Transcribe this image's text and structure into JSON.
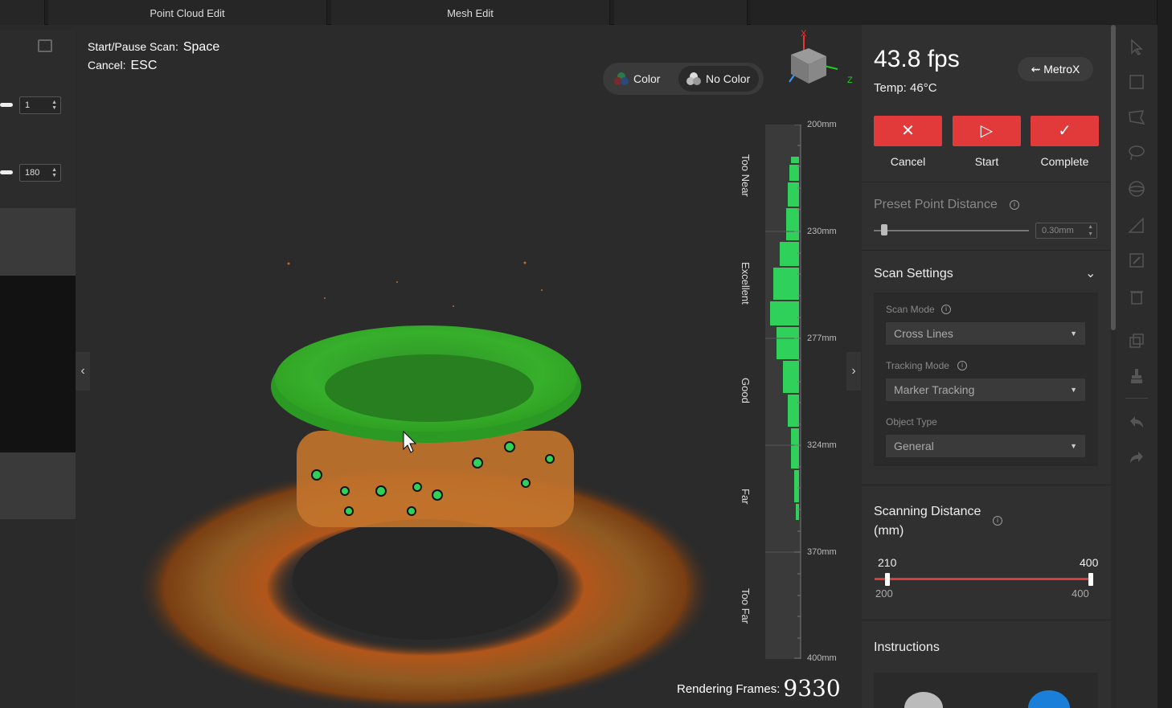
{
  "tabs": [
    {
      "label": ""
    },
    {
      "label": "Point Cloud Edit"
    },
    {
      "label": "Mesh Edit"
    },
    {
      "label": ""
    },
    {
      "label": ""
    }
  ],
  "left_panel": {
    "spin1": "1",
    "spin2": "180"
  },
  "viewport": {
    "hint_scan_label": "Start/Pause Scan:",
    "hint_scan_key": "Space",
    "hint_cancel_label": "Cancel:",
    "hint_cancel_key": "ESC",
    "color_label": "Color",
    "no_color_label": "No Color",
    "axis_x": "X",
    "axis_z": "Z",
    "gauge": {
      "zones": [
        "Too Near",
        "Excellent",
        "Good",
        "Far",
        "Too Far"
      ],
      "ticks": [
        "200mm",
        "230mm",
        "277mm",
        "324mm",
        "370mm",
        "400mm"
      ],
      "fill_color": "#2fd15a"
    },
    "rendering_frames_label": "Rendering Frames:",
    "rendering_frames_value": "9330"
  },
  "right_panel": {
    "fps": "43.8 fps",
    "temp_label": "Temp:",
    "temp_value": "46°C",
    "device_name": "MetroX",
    "actions": [
      {
        "label": "Cancel",
        "icon": "close-icon"
      },
      {
        "label": "Start",
        "icon": "play-icon"
      },
      {
        "label": "Complete",
        "icon": "check-icon"
      }
    ],
    "accent": "#e2393b",
    "preset_point_distance": {
      "title": "Preset Point Distance",
      "value": "0.30mm"
    },
    "scan_settings": {
      "title": "Scan Settings",
      "scan_mode_label": "Scan Mode",
      "scan_mode_value": "Cross Lines",
      "tracking_mode_label": "Tracking Mode",
      "tracking_mode_value": "Marker Tracking",
      "object_type_label": "Object Type",
      "object_type_value": "General"
    },
    "scanning_distance": {
      "title_line1": "Scanning Distance",
      "title_line2": "(mm)",
      "low_value": "210",
      "high_value": "400",
      "min": "200",
      "max": "400"
    },
    "instructions_title": "Instructions"
  }
}
